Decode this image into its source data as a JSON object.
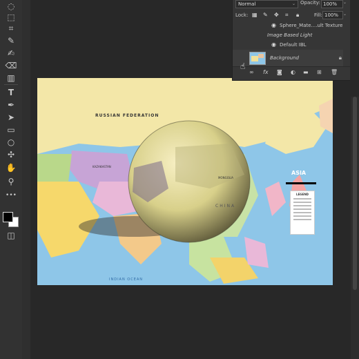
{
  "toolbar": {
    "tools": [
      {
        "name": "lasso-tool-icon",
        "glyph": "◌"
      },
      {
        "name": "quick-select-tool-icon",
        "glyph": "⬚"
      },
      {
        "name": "crop-tool-icon",
        "glyph": "⌗"
      },
      {
        "name": "eyedropper-tool-icon",
        "glyph": "✎"
      },
      {
        "name": "brush-tool-icon",
        "glyph": "✍"
      },
      {
        "name": "stamp-tool-icon",
        "glyph": "♣"
      },
      {
        "name": "eraser-tool-icon",
        "glyph": "⌫"
      },
      {
        "name": "gradient-tool-icon",
        "glyph": "▥"
      },
      {
        "name": "type-tool-icon",
        "glyph": "T"
      },
      {
        "name": "pen-tool-icon",
        "glyph": "✒"
      },
      {
        "name": "path-select-tool-icon",
        "glyph": "➤"
      },
      {
        "name": "rectangle-tool-icon",
        "glyph": "▭"
      },
      {
        "name": "ellipse-tool-icon",
        "glyph": "○"
      },
      {
        "name": "3d-tool-icon",
        "glyph": "✣"
      },
      {
        "name": "hand-tool-icon",
        "glyph": "✋"
      },
      {
        "name": "zoom-tool-icon",
        "glyph": "⚲"
      },
      {
        "name": "more-tools-icon",
        "glyph": "•••"
      }
    ]
  },
  "map": {
    "russia_label": "RUSSIAN FEDERATION",
    "asia_label": "ASIA",
    "indian_ocean_label": "INDIAN OCEAN",
    "mongolia_label": "MONGOLIA",
    "china_label": "CHINA",
    "kazakhstan_label": "KAZAKHSTAN",
    "legend_title": "LEGEND"
  },
  "layers_panel": {
    "blend_mode": "Normal",
    "opacity_label": "Opacity:",
    "opacity_value": "100%",
    "lock_label": "Lock:",
    "fill_label": "Fill:",
    "fill_value": "100%",
    "layers": {
      "sphere_texture": "Sphere_Mate....ult Texture",
      "ibl_header": "Image Based Light",
      "default_ibl": "Default IBL",
      "background": "Background"
    }
  },
  "colors": {
    "foreground": "#000000",
    "background": "#ffffff",
    "app_bg": "#282828",
    "panel_bg": "#363636"
  }
}
